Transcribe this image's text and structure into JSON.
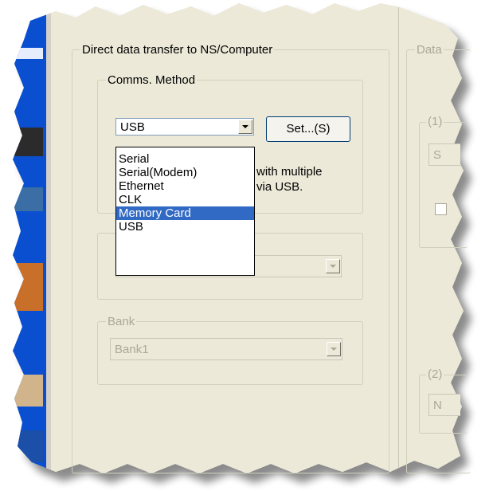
{
  "dialog": {
    "direct_transfer_group": "Direct data transfer to NS/Computer",
    "right_group_partial": "Data",
    "right_sub1_partial": "(1)",
    "right_sub1_field_partial": "S",
    "right_sub2_partial": "(2)",
    "right_sub2_field_partial": "N"
  },
  "comms": {
    "group_label": "Comms. Method",
    "selected_value": "USB",
    "set_button_label": "Set...(S)",
    "note_line1": "with multiple",
    "note_line2": "via USB.",
    "options": [
      "Serial",
      "Serial(Modem)",
      "Ethernet",
      "CLK",
      "Memory Card",
      "USB"
    ],
    "highlighted_option": "Memory Card"
  },
  "bank": {
    "group_label": "Bank",
    "value": "Bank1"
  },
  "colors": {
    "dialog_bg": "#ece9d8",
    "highlight": "#316ac5",
    "group_border": "#d0d0bf",
    "disabled_text": "#aca899",
    "app_blue": "#0a4fd0"
  }
}
